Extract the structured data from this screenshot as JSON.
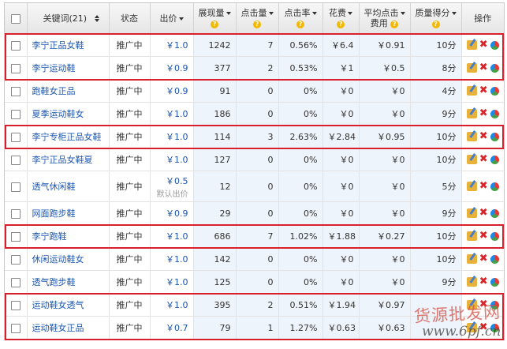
{
  "header": {
    "keyword_label": "关键词(21)",
    "status_label": "状态",
    "bid_label": "出价",
    "impressions_label": "展现量",
    "clicks_label": "点击量",
    "ctr_label": "点击率",
    "cost_label": "花费",
    "avg_cpc_label_1": "平均点击",
    "avg_cpc_label_2": "费用",
    "quality_label": "质量得分",
    "actions_label": "操作",
    "help_glyph": "?"
  },
  "rows": [
    {
      "keyword": "李宁正品女鞋",
      "status": "推广中",
      "bid": "￥1.0",
      "bid_note": "",
      "impressions": "1242",
      "clicks": "7",
      "ctr": "0.56%",
      "cost": "￥6.4",
      "avg_cpc": "￥0.91",
      "quality": "10分"
    },
    {
      "keyword": "李宁运动鞋",
      "status": "推广中",
      "bid": "￥0.9",
      "bid_note": "",
      "impressions": "377",
      "clicks": "2",
      "ctr": "0.53%",
      "cost": "￥1",
      "avg_cpc": "￥0.5",
      "quality": "8分"
    },
    {
      "keyword": "跑鞋女正品",
      "status": "推广中",
      "bid": "￥0.9",
      "bid_note": "",
      "impressions": "91",
      "clicks": "0",
      "ctr": "0%",
      "cost": "￥0",
      "avg_cpc": "￥0",
      "quality": "4分"
    },
    {
      "keyword": "夏季运动鞋女",
      "status": "推广中",
      "bid": "￥1.0",
      "bid_note": "",
      "impressions": "186",
      "clicks": "0",
      "ctr": "0%",
      "cost": "￥0",
      "avg_cpc": "￥0",
      "quality": "9分"
    },
    {
      "keyword": "李宁专柜正品女鞋",
      "status": "推广中",
      "bid": "￥1.0",
      "bid_note": "",
      "impressions": "114",
      "clicks": "3",
      "ctr": "2.63%",
      "cost": "￥2.84",
      "avg_cpc": "￥0.95",
      "quality": "10分"
    },
    {
      "keyword": "李宁正品女鞋夏",
      "status": "推广中",
      "bid": "￥1.0",
      "bid_note": "",
      "impressions": "127",
      "clicks": "0",
      "ctr": "0%",
      "cost": "￥0",
      "avg_cpc": "￥0",
      "quality": "10分"
    },
    {
      "keyword": "透气休闲鞋",
      "status": "推广中",
      "bid": "￥0.5",
      "bid_note": "默认出价",
      "impressions": "12",
      "clicks": "0",
      "ctr": "0%",
      "cost": "￥0",
      "avg_cpc": "￥0",
      "quality": "5分"
    },
    {
      "keyword": "网面跑步鞋",
      "status": "推广中",
      "bid": "￥0.9",
      "bid_note": "",
      "impressions": "29",
      "clicks": "0",
      "ctr": "0%",
      "cost": "￥0",
      "avg_cpc": "￥0",
      "quality": "9分"
    },
    {
      "keyword": "李宁跑鞋",
      "status": "推广中",
      "bid": "￥1.0",
      "bid_note": "",
      "impressions": "686",
      "clicks": "7",
      "ctr": "1.02%",
      "cost": "￥1.88",
      "avg_cpc": "￥0.27",
      "quality": "10分"
    },
    {
      "keyword": "休闲运动鞋女",
      "status": "推广中",
      "bid": "￥1.0",
      "bid_note": "",
      "impressions": "142",
      "clicks": "0",
      "ctr": "0%",
      "cost": "￥0",
      "avg_cpc": "￥0",
      "quality": "10分"
    },
    {
      "keyword": "透气跑步鞋",
      "status": "推广中",
      "bid": "￥1.0",
      "bid_note": "",
      "impressions": "125",
      "clicks": "0",
      "ctr": "0%",
      "cost": "￥0",
      "avg_cpc": "￥0",
      "quality": "9分"
    },
    {
      "keyword": "运动鞋女透气",
      "status": "推广中",
      "bid": "￥1.0",
      "bid_note": "",
      "impressions": "395",
      "clicks": "2",
      "ctr": "0.51%",
      "cost": "￥1.94",
      "avg_cpc": "￥0.97",
      "quality": ""
    },
    {
      "keyword": "运动鞋女正品",
      "status": "推广中",
      "bid": "￥0.7",
      "bid_note": "",
      "impressions": "79",
      "clicks": "1",
      "ctr": "1.27%",
      "cost": "￥0.63",
      "avg_cpc": "￥0.63",
      "quality": ""
    }
  ],
  "highlighted_rows": [
    [
      0,
      1
    ],
    [
      4,
      4
    ],
    [
      8,
      8
    ],
    [
      11,
      12
    ]
  ],
  "colors": {
    "highlight": "#d81f2b",
    "link": "#1a55b0",
    "metric_bg": "#eef4fb"
  },
  "icons": {
    "edit": "pencil-folder-icon",
    "delete": "red-x-icon",
    "report": "pie-chart-icon",
    "help": "question-circle-icon"
  },
  "watermark": {
    "line1": "货源批发网",
    "line2": "www.6pf.cn"
  }
}
